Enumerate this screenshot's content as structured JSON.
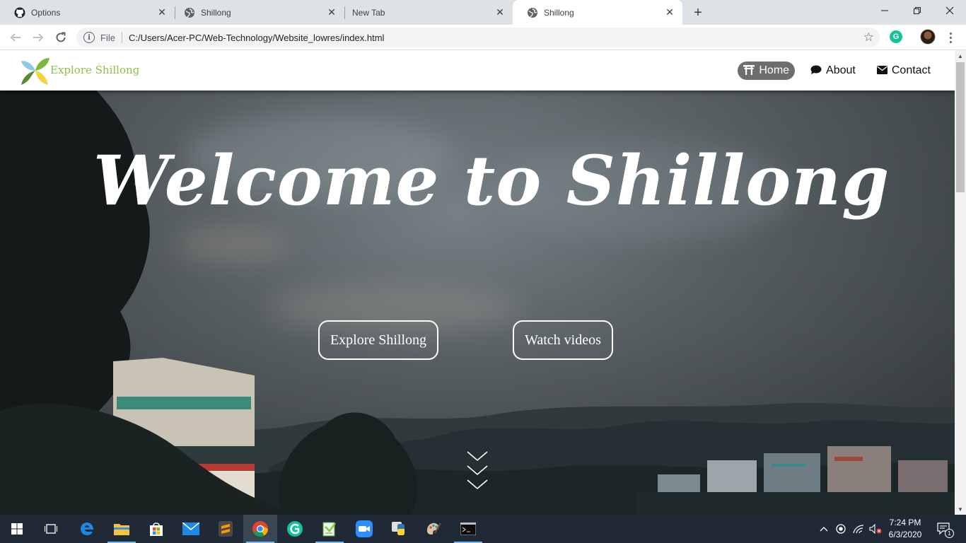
{
  "browser": {
    "tabs": [
      {
        "title": "Options",
        "icon": "github-icon",
        "active": false
      },
      {
        "title": "Shillong",
        "icon": "globe-icon",
        "active": false
      },
      {
        "title": "New Tab",
        "icon": "",
        "active": false
      },
      {
        "title": "Shillong",
        "icon": "globe-icon",
        "active": true
      }
    ],
    "new_tab_label": "+",
    "window_controls": {
      "minimize": "—",
      "maximize": "❐",
      "close": "✕"
    },
    "address": {
      "scheme_label": "File",
      "url": "C:/Users/Acer-PC/Web-Technology/Website_lowres/index.html"
    },
    "extension_badge": "G"
  },
  "site": {
    "brand": "Explore Shillong",
    "nav": [
      {
        "label": "Home",
        "icon": "torii-gate-icon",
        "current": true
      },
      {
        "label": "About",
        "icon": "speech-bubble-icon",
        "current": false
      },
      {
        "label": "Contact",
        "icon": "envelope-icon",
        "current": false
      }
    ],
    "hero_title": "Welcome to Shillong",
    "buttons": {
      "explore": "Explore Shillong",
      "videos": "Watch videos"
    }
  },
  "taskbar": {
    "apps": [
      "windows-start-icon",
      "task-view-icon",
      "edge-icon",
      "file-explorer-icon",
      "store-icon",
      "mail-icon",
      "sublime-text-icon",
      "chrome-icon",
      "grammarly-icon",
      "notepad-icon",
      "zoom-icon",
      "python-icon",
      "paint-icon",
      "terminal-icon"
    ],
    "clock": {
      "time": "7:24 PM",
      "date": "6/3/2020"
    },
    "notification_count": "1"
  },
  "colors": {
    "brand_green": "#8bc34a",
    "nav_active_bg": "#6e6e6e",
    "taskbar_bg": "#1f2a36"
  }
}
